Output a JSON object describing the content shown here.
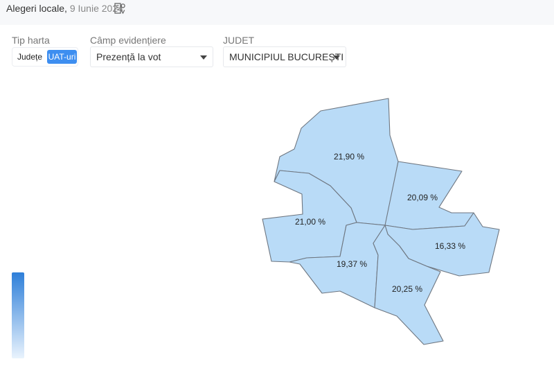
{
  "header": {
    "title": "Alegeri locale,",
    "date": "9 Iunie 2024",
    "icon": "building-location-icon"
  },
  "controls": {
    "map_type": {
      "label": "Tip harta",
      "options": [
        "Județe",
        "UAT-uri"
      ],
      "selected": "UAT-uri"
    },
    "highlight_field": {
      "label": "Câmp evidențiere",
      "value": "Prezență la vot"
    },
    "county": {
      "label": "JUDET",
      "value": "MUNICIPIUL BUCUREȘTI"
    }
  },
  "map": {
    "fill_color": "#b9dbf7",
    "stroke_color": "#6e7680",
    "regions": [
      {
        "label": "21,90 %",
        "value": 21.9
      },
      {
        "label": "20,09 %",
        "value": 20.09
      },
      {
        "label": "21,00 %",
        "value": 21.0
      },
      {
        "label": "16,33 %",
        "value": 16.33
      },
      {
        "label": "19,37 %",
        "value": 19.37
      },
      {
        "label": "20,25 %",
        "value": 20.25
      }
    ]
  },
  "legend": {
    "color_high": "#2e7fd9",
    "color_low": "#e9f3fd"
  }
}
